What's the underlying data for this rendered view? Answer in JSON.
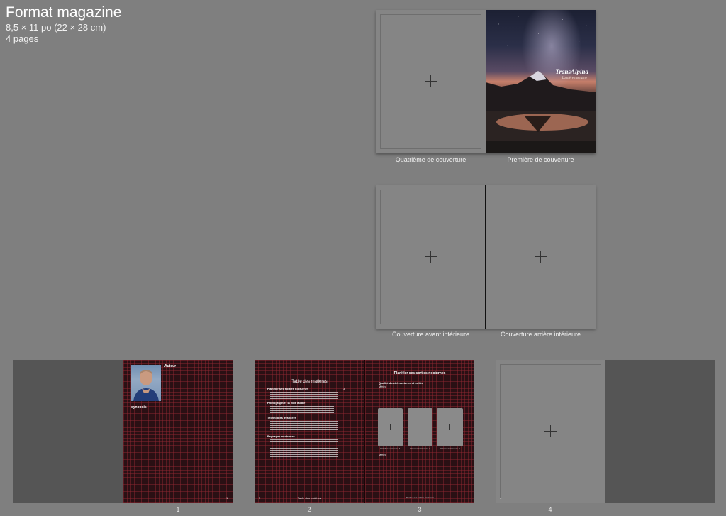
{
  "header": {
    "title": "Format magazine",
    "size": "8,5 × 11 po (22 × 28 cm)",
    "pages": "4 pages"
  },
  "spreads": {
    "cover": {
      "left_caption": "Quatrième de couverture",
      "right_caption": "Première de couverture",
      "cover_title": "TransAlpina",
      "cover_subtitle": "Lumière nocturne"
    },
    "inside_cover": {
      "left_caption": "Couverture avant intérieure",
      "right_caption": "Couverture arrière intérieure"
    }
  },
  "page1": {
    "author_label": "Auteur",
    "synopsis_label": "synopsis",
    "folio": "1",
    "number": "1"
  },
  "page2": {
    "toc_title": "Table des matières",
    "sections": [
      {
        "title": "Planifier ses sorties nocturnes",
        "page": "3"
      },
      {
        "title": "Photographier la voie lactée",
        "page": ""
      },
      {
        "title": "Techniques avancées",
        "page": ""
      },
      {
        "title": "Paysages nocturnes",
        "page": ""
      }
    ],
    "footer_folio": "2",
    "footer_text": "Table des matières",
    "number": "2"
  },
  "page3": {
    "title": "Planifier ses sorties nocturnes",
    "subtitle": "Qualité du ciel nocturne et météo",
    "subtitle2": "Météo",
    "captions": [
      "Rotation lumineuse 1",
      "Rotation lumineuse 2",
      "Rotation lumineuse 3"
    ],
    "note": "Météo",
    "footer_text": "Planifier ses sorties nocturnes",
    "number": "3"
  },
  "page4": {
    "folio": "4",
    "number": "4"
  }
}
